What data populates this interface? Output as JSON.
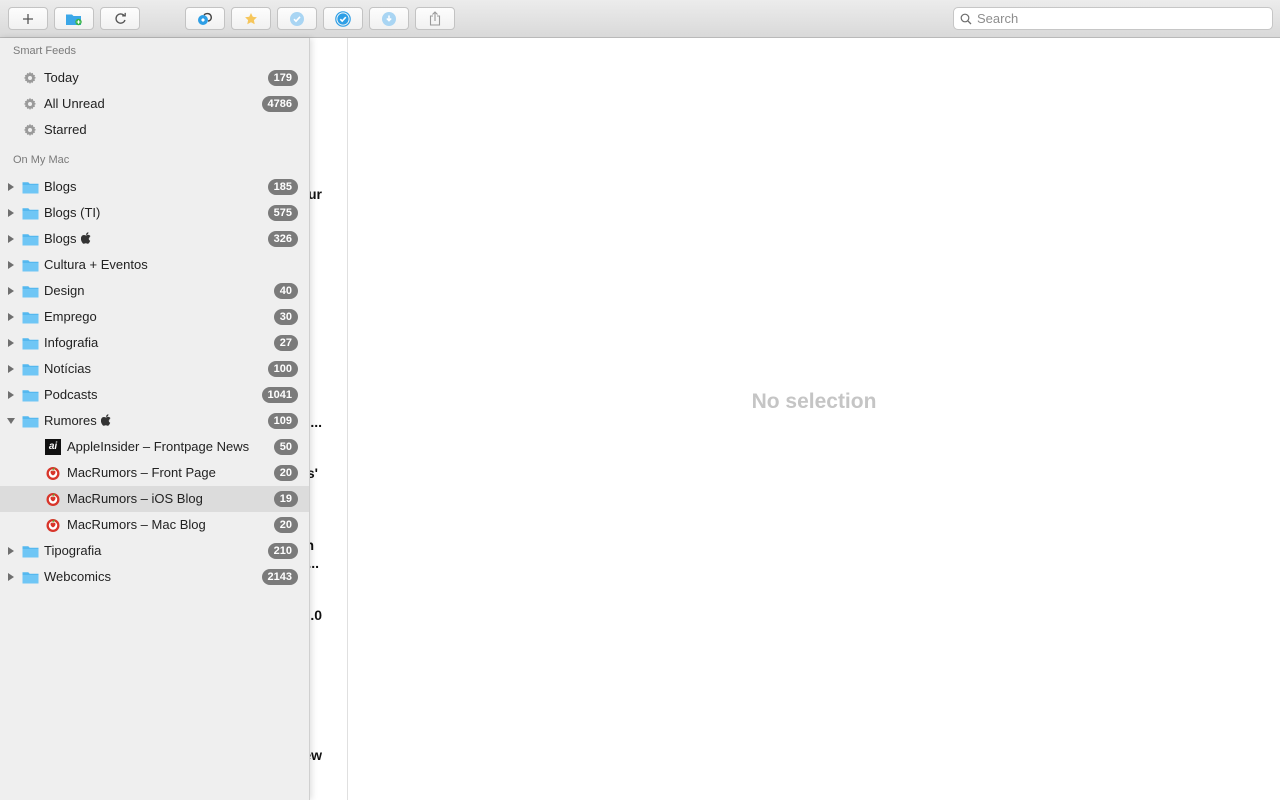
{
  "toolbar": {
    "buttons": [
      {
        "name": "add-feed-button",
        "icon": "plus-icon"
      },
      {
        "name": "new-folder-button",
        "icon": "folder-add-icon"
      },
      {
        "name": "refresh-button",
        "icon": "refresh-icon"
      },
      {
        "name": "open-in-browser-button",
        "icon": "safari-icon"
      },
      {
        "name": "star-button",
        "icon": "star-icon"
      },
      {
        "name": "mark-read-button",
        "icon": "check-icon"
      },
      {
        "name": "mark-all-read-button",
        "icon": "check-all-icon"
      },
      {
        "name": "next-unread-button",
        "icon": "next-unread-icon"
      },
      {
        "name": "share-button",
        "icon": "share-icon"
      }
    ],
    "search": {
      "placeholder": "Search"
    }
  },
  "sidebar": {
    "smart_feeds": {
      "header": "Smart Feeds",
      "items": [
        {
          "label": "Today",
          "count": "179",
          "icon": "gear-icon"
        },
        {
          "label": "All Unread",
          "count": "4786",
          "icon": "gear-icon"
        },
        {
          "label": "Starred",
          "count": "",
          "icon": "gear-icon"
        }
      ]
    },
    "on_my_mac": {
      "header": "On My Mac",
      "folders": [
        {
          "label": "Blogs",
          "count": "185",
          "expanded": false,
          "apple_logo": false
        },
        {
          "label": "Blogs (TI)",
          "count": "575",
          "expanded": false,
          "apple_logo": false
        },
        {
          "label": "Blogs",
          "count": "326",
          "expanded": false,
          "apple_logo": true
        },
        {
          "label": "Cultura + Eventos",
          "count": "",
          "expanded": false,
          "apple_logo": false
        },
        {
          "label": "Design",
          "count": "40",
          "expanded": false,
          "apple_logo": false
        },
        {
          "label": "Emprego",
          "count": "30",
          "expanded": false,
          "apple_logo": false
        },
        {
          "label": "Infografia",
          "count": "27",
          "expanded": false,
          "apple_logo": false
        },
        {
          "label": "Notícias",
          "count": "100",
          "expanded": false,
          "apple_logo": false
        },
        {
          "label": "Podcasts",
          "count": "1041",
          "expanded": false,
          "apple_logo": false
        },
        {
          "label": "Rumores",
          "count": "109",
          "expanded": true,
          "apple_logo": true
        }
      ],
      "rumores_feeds": [
        {
          "label": "AppleInsider – Frontpage News",
          "count": "50",
          "icon": "appleinsider-icon",
          "icon_text": "ai",
          "selected": false
        },
        {
          "label": "MacRumors – Front Page",
          "count": "20",
          "icon": "macrumors-icon",
          "selected": false
        },
        {
          "label": "MacRumors – iOS Blog",
          "count": "19",
          "icon": "macrumors-icon",
          "selected": true
        },
        {
          "label": "MacRumors – Mac Blog",
          "count": "20",
          "icon": "macrumors-icon",
          "selected": false
        }
      ],
      "folders_after": [
        {
          "label": "Tipografia",
          "count": "210",
          "expanded": false,
          "apple_logo": false
        },
        {
          "label": "Webcomics",
          "count": "2143",
          "expanded": false,
          "apple_logo": false
        }
      ]
    }
  },
  "article_list": {
    "fragments": [
      "ur",
      "e...",
      "s'",
      "n",
      "...",
      ".0",
      "ew"
    ]
  },
  "detail": {
    "empty_text": "No selection"
  },
  "colors": {
    "folder": "#55b8ef",
    "badge": "#7b7b7b",
    "selection": "#dcdcdc",
    "accent": "#2e9fe6",
    "star": "#f6c65b"
  }
}
